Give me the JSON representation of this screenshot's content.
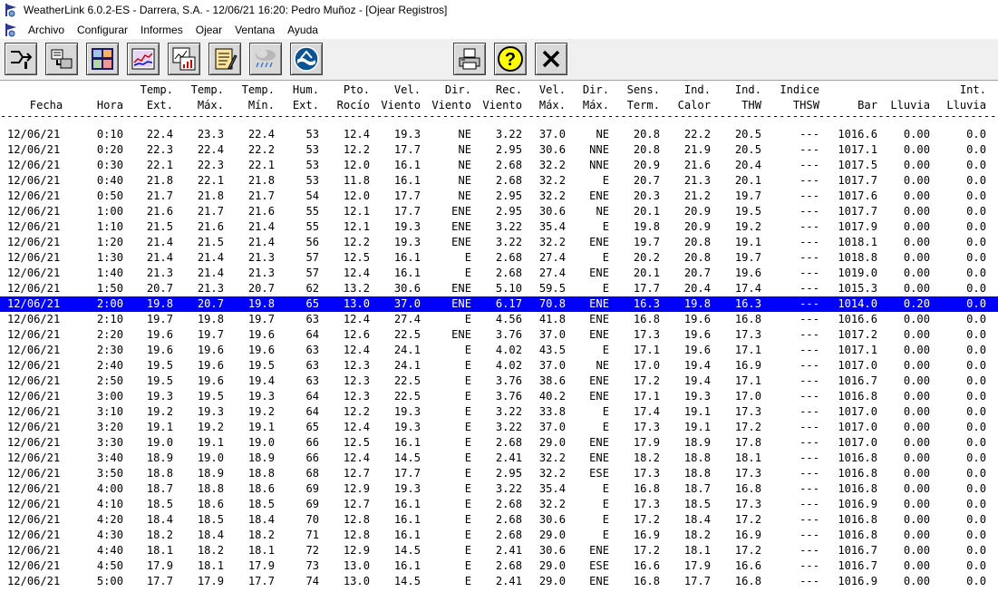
{
  "window": {
    "title": "WeatherLink 6.0.2-ES  -  Darrera, S.A.  -  12/06/21  16:20: Pedro Muñoz - [Ojear Registros]"
  },
  "menu": [
    "Archivo",
    "Configurar",
    "Informes",
    "Ojear",
    "Ventana",
    "Ayuda"
  ],
  "toolbar": {
    "buttons": [
      {
        "name": "connect-station-icon"
      },
      {
        "name": "download-data-icon"
      },
      {
        "name": "bulletin-icon"
      },
      {
        "name": "strip-charts-icon"
      },
      {
        "name": "plot-data-icon"
      },
      {
        "name": "notes-icon"
      },
      {
        "name": "weather-rain-icon"
      },
      {
        "name": "noaa-logo-icon"
      },
      {
        "name": "print-icon"
      },
      {
        "name": "help-icon"
      },
      {
        "name": "close-icon"
      }
    ]
  },
  "table": {
    "headers": [
      [
        "",
        "Fecha"
      ],
      [
        "",
        "Hora"
      ],
      [
        "Temp.",
        "Ext."
      ],
      [
        "Temp.",
        "Máx."
      ],
      [
        "Temp.",
        "Mín."
      ],
      [
        "Hum.",
        "Ext."
      ],
      [
        "Pto.",
        "Rocío"
      ],
      [
        "Vel.",
        "Viento"
      ],
      [
        "Dir.",
        "Viento"
      ],
      [
        "Rec.",
        "Viento"
      ],
      [
        "Vel.",
        "Máx."
      ],
      [
        "Dir.",
        "Máx."
      ],
      [
        "Sens.",
        "Term."
      ],
      [
        "Ind.",
        "Calor"
      ],
      [
        "Ind.",
        "THW"
      ],
      [
        "Indice",
        "THSW"
      ],
      [
        "",
        "Bar"
      ],
      [
        "",
        "Lluvia"
      ],
      [
        "Int.",
        "Lluvia"
      ]
    ],
    "separator": "---------------------------------------------------------------------------------------------------------------------------------------------------------------------------------------------------------------------------------------------------------------------------------",
    "selected_index": 11,
    "rows": [
      [
        "12/06/21",
        "0:10",
        "22.4",
        "23.3",
        "22.4",
        "53",
        "12.4",
        "19.3",
        "NE",
        "3.22",
        "37.0",
        "NE",
        "20.8",
        "22.2",
        "20.5",
        "---",
        "1016.6",
        "0.00",
        "0.0"
      ],
      [
        "12/06/21",
        "0:20",
        "22.3",
        "22.4",
        "22.2",
        "53",
        "12.2",
        "17.7",
        "NE",
        "2.95",
        "30.6",
        "NNE",
        "20.8",
        "21.9",
        "20.5",
        "---",
        "1017.1",
        "0.00",
        "0.0"
      ],
      [
        "12/06/21",
        "0:30",
        "22.1",
        "22.3",
        "22.1",
        "53",
        "12.0",
        "16.1",
        "NE",
        "2.68",
        "32.2",
        "NNE",
        "20.9",
        "21.6",
        "20.4",
        "---",
        "1017.5",
        "0.00",
        "0.0"
      ],
      [
        "12/06/21",
        "0:40",
        "21.8",
        "22.1",
        "21.8",
        "53",
        "11.8",
        "16.1",
        "NE",
        "2.68",
        "32.2",
        "E",
        "20.7",
        "21.3",
        "20.1",
        "---",
        "1017.7",
        "0.00",
        "0.0"
      ],
      [
        "12/06/21",
        "0:50",
        "21.7",
        "21.8",
        "21.7",
        "54",
        "12.0",
        "17.7",
        "NE",
        "2.95",
        "32.2",
        "ENE",
        "20.3",
        "21.2",
        "19.7",
        "---",
        "1017.6",
        "0.00",
        "0.0"
      ],
      [
        "12/06/21",
        "1:00",
        "21.6",
        "21.7",
        "21.6",
        "55",
        "12.1",
        "17.7",
        "ENE",
        "2.95",
        "30.6",
        "NE",
        "20.1",
        "20.9",
        "19.5",
        "---",
        "1017.7",
        "0.00",
        "0.0"
      ],
      [
        "12/06/21",
        "1:10",
        "21.5",
        "21.6",
        "21.4",
        "55",
        "12.1",
        "19.3",
        "ENE",
        "3.22",
        "35.4",
        "E",
        "19.8",
        "20.9",
        "19.2",
        "---",
        "1017.9",
        "0.00",
        "0.0"
      ],
      [
        "12/06/21",
        "1:20",
        "21.4",
        "21.5",
        "21.4",
        "56",
        "12.2",
        "19.3",
        "ENE",
        "3.22",
        "32.2",
        "ENE",
        "19.7",
        "20.8",
        "19.1",
        "---",
        "1018.1",
        "0.00",
        "0.0"
      ],
      [
        "12/06/21",
        "1:30",
        "21.4",
        "21.4",
        "21.3",
        "57",
        "12.5",
        "16.1",
        "E",
        "2.68",
        "27.4",
        "E",
        "20.2",
        "20.8",
        "19.7",
        "---",
        "1018.8",
        "0.00",
        "0.0"
      ],
      [
        "12/06/21",
        "1:40",
        "21.3",
        "21.4",
        "21.3",
        "57",
        "12.4",
        "16.1",
        "E",
        "2.68",
        "27.4",
        "ENE",
        "20.1",
        "20.7",
        "19.6",
        "---",
        "1019.0",
        "0.00",
        "0.0"
      ],
      [
        "12/06/21",
        "1:50",
        "20.7",
        "21.3",
        "20.7",
        "62",
        "13.2",
        "30.6",
        "ENE",
        "5.10",
        "59.5",
        "E",
        "17.7",
        "20.4",
        "17.4",
        "---",
        "1015.3",
        "0.00",
        "0.0"
      ],
      [
        "12/06/21",
        "2:00",
        "19.8",
        "20.7",
        "19.8",
        "65",
        "13.0",
        "37.0",
        "ENE",
        "6.17",
        "70.8",
        "ENE",
        "16.3",
        "19.8",
        "16.3",
        "---",
        "1014.0",
        "0.20",
        "0.0"
      ],
      [
        "12/06/21",
        "2:10",
        "19.7",
        "19.8",
        "19.7",
        "63",
        "12.4",
        "27.4",
        "E",
        "4.56",
        "41.8",
        "ENE",
        "16.8",
        "19.6",
        "16.8",
        "---",
        "1016.6",
        "0.00",
        "0.0"
      ],
      [
        "12/06/21",
        "2:20",
        "19.6",
        "19.7",
        "19.6",
        "64",
        "12.6",
        "22.5",
        "ENE",
        "3.76",
        "37.0",
        "ENE",
        "17.3",
        "19.6",
        "17.3",
        "---",
        "1017.2",
        "0.00",
        "0.0"
      ],
      [
        "12/06/21",
        "2:30",
        "19.6",
        "19.6",
        "19.6",
        "63",
        "12.4",
        "24.1",
        "E",
        "4.02",
        "43.5",
        "E",
        "17.1",
        "19.6",
        "17.1",
        "---",
        "1017.1",
        "0.00",
        "0.0"
      ],
      [
        "12/06/21",
        "2:40",
        "19.5",
        "19.6",
        "19.5",
        "63",
        "12.3",
        "24.1",
        "E",
        "4.02",
        "37.0",
        "NE",
        "17.0",
        "19.4",
        "16.9",
        "---",
        "1017.0",
        "0.00",
        "0.0"
      ],
      [
        "12/06/21",
        "2:50",
        "19.5",
        "19.6",
        "19.4",
        "63",
        "12.3",
        "22.5",
        "E",
        "3.76",
        "38.6",
        "ENE",
        "17.2",
        "19.4",
        "17.1",
        "---",
        "1016.7",
        "0.00",
        "0.0"
      ],
      [
        "12/06/21",
        "3:00",
        "19.3",
        "19.5",
        "19.3",
        "64",
        "12.3",
        "22.5",
        "E",
        "3.76",
        "40.2",
        "ENE",
        "17.1",
        "19.3",
        "17.0",
        "---",
        "1016.8",
        "0.00",
        "0.0"
      ],
      [
        "12/06/21",
        "3:10",
        "19.2",
        "19.3",
        "19.2",
        "64",
        "12.2",
        "19.3",
        "E",
        "3.22",
        "33.8",
        "E",
        "17.4",
        "19.1",
        "17.3",
        "---",
        "1017.0",
        "0.00",
        "0.0"
      ],
      [
        "12/06/21",
        "3:20",
        "19.1",
        "19.2",
        "19.1",
        "65",
        "12.4",
        "19.3",
        "E",
        "3.22",
        "37.0",
        "E",
        "17.3",
        "19.1",
        "17.2",
        "---",
        "1017.0",
        "0.00",
        "0.0"
      ],
      [
        "12/06/21",
        "3:30",
        "19.0",
        "19.1",
        "19.0",
        "66",
        "12.5",
        "16.1",
        "E",
        "2.68",
        "29.0",
        "ENE",
        "17.9",
        "18.9",
        "17.8",
        "---",
        "1017.0",
        "0.00",
        "0.0"
      ],
      [
        "12/06/21",
        "3:40",
        "18.9",
        "19.0",
        "18.9",
        "66",
        "12.4",
        "14.5",
        "E",
        "2.41",
        "32.2",
        "ENE",
        "18.2",
        "18.8",
        "18.1",
        "---",
        "1016.8",
        "0.00",
        "0.0"
      ],
      [
        "12/06/21",
        "3:50",
        "18.8",
        "18.9",
        "18.8",
        "68",
        "12.7",
        "17.7",
        "E",
        "2.95",
        "32.2",
        "ESE",
        "17.3",
        "18.8",
        "17.3",
        "---",
        "1016.8",
        "0.00",
        "0.0"
      ],
      [
        "12/06/21",
        "4:00",
        "18.7",
        "18.8",
        "18.6",
        "69",
        "12.9",
        "19.3",
        "E",
        "3.22",
        "35.4",
        "E",
        "16.8",
        "18.7",
        "16.8",
        "---",
        "1016.8",
        "0.00",
        "0.0"
      ],
      [
        "12/06/21",
        "4:10",
        "18.5",
        "18.6",
        "18.5",
        "69",
        "12.7",
        "16.1",
        "E",
        "2.68",
        "32.2",
        "E",
        "17.3",
        "18.5",
        "17.3",
        "---",
        "1016.9",
        "0.00",
        "0.0"
      ],
      [
        "12/06/21",
        "4:20",
        "18.4",
        "18.5",
        "18.4",
        "70",
        "12.8",
        "16.1",
        "E",
        "2.68",
        "30.6",
        "E",
        "17.2",
        "18.4",
        "17.2",
        "---",
        "1016.8",
        "0.00",
        "0.0"
      ],
      [
        "12/06/21",
        "4:30",
        "18.2",
        "18.4",
        "18.2",
        "71",
        "12.8",
        "16.1",
        "E",
        "2.68",
        "29.0",
        "E",
        "16.9",
        "18.2",
        "16.9",
        "---",
        "1016.8",
        "0.00",
        "0.0"
      ],
      [
        "12/06/21",
        "4:40",
        "18.1",
        "18.2",
        "18.1",
        "72",
        "12.9",
        "14.5",
        "E",
        "2.41",
        "30.6",
        "ENE",
        "17.2",
        "18.1",
        "17.2",
        "---",
        "1016.7",
        "0.00",
        "0.0"
      ],
      [
        "12/06/21",
        "4:50",
        "17.9",
        "18.1",
        "17.9",
        "73",
        "13.0",
        "16.1",
        "E",
        "2.68",
        "29.0",
        "ESE",
        "16.6",
        "17.9",
        "16.6",
        "---",
        "1016.7",
        "0.00",
        "0.0"
      ],
      [
        "12/06/21",
        "5:00",
        "17.7",
        "17.9",
        "17.7",
        "74",
        "13.0",
        "14.5",
        "E",
        "2.41",
        "29.0",
        "ENE",
        "16.8",
        "17.7",
        "16.8",
        "---",
        "1016.9",
        "0.00",
        "0.0"
      ]
    ]
  }
}
